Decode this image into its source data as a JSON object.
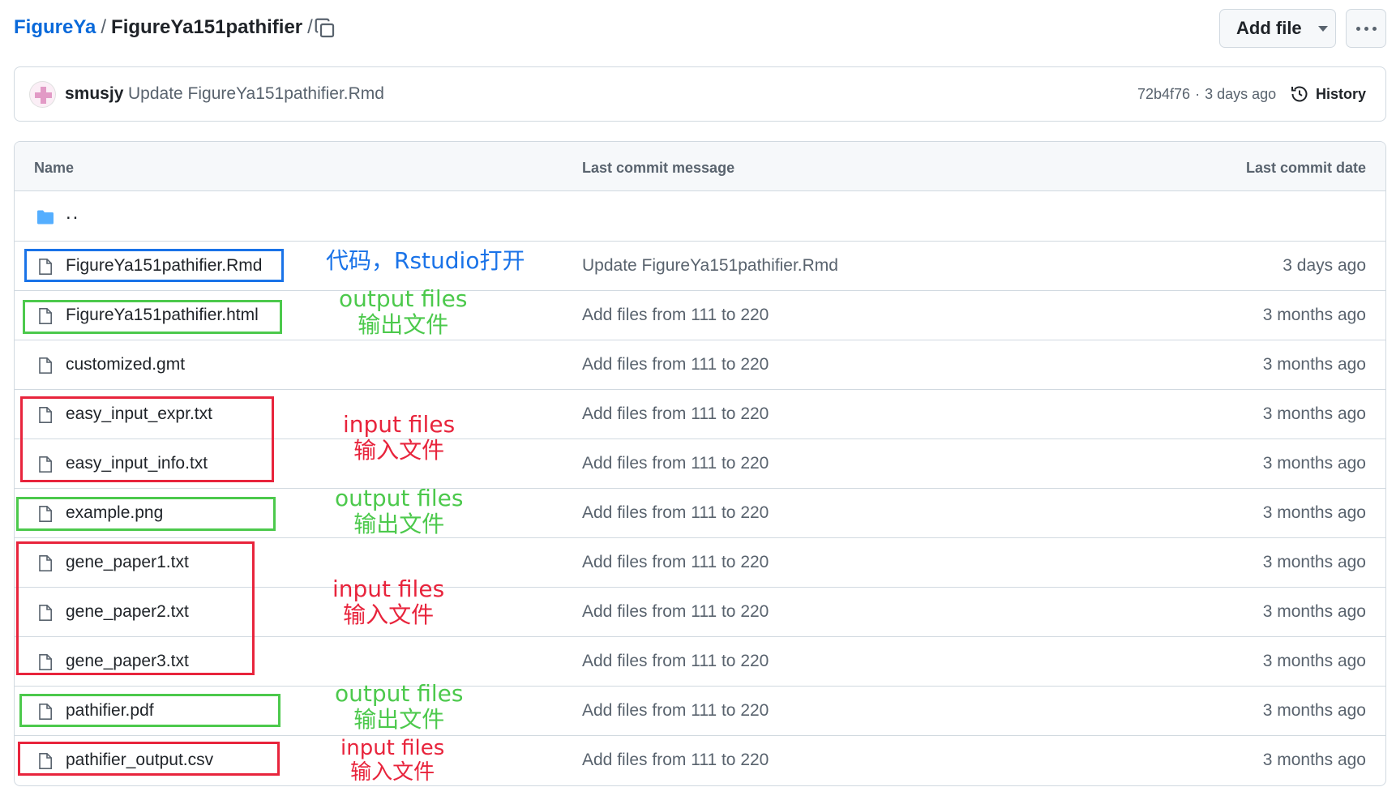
{
  "breadcrumb": {
    "owner": "FigureYa",
    "separator": "/",
    "repo": "FigureYa151pathifier",
    "trailing_separator": "/"
  },
  "toolbar": {
    "add_file_label": "Add file",
    "more_icon": "kebab-horizontal-icon",
    "copy_icon": "copy-icon"
  },
  "commit": {
    "author": "smusjy",
    "message": "Update FigureYa151pathifier.Rmd",
    "sha": "72b4f76",
    "dot": "·",
    "age": "3 days ago",
    "history_label": "History"
  },
  "table": {
    "headers": {
      "name": "Name",
      "message": "Last commit message",
      "date": "Last commit date"
    },
    "parent_dir": "..",
    "files": [
      {
        "name": "FigureYa151pathifier.Rmd",
        "message": "Update FigureYa151pathifier.Rmd",
        "date": "3 days ago"
      },
      {
        "name": "FigureYa151pathifier.html",
        "message": "Add files from 111 to 220",
        "date": "3 months ago"
      },
      {
        "name": "customized.gmt",
        "message": "Add files from 111 to 220",
        "date": "3 months ago"
      },
      {
        "name": "easy_input_expr.txt",
        "message": "Add files from 111 to 220",
        "date": "3 months ago"
      },
      {
        "name": "easy_input_info.txt",
        "message": "Add files from 111 to 220",
        "date": "3 months ago"
      },
      {
        "name": "example.png",
        "message": "Add files from 111 to 220",
        "date": "3 months ago"
      },
      {
        "name": "gene_paper1.txt",
        "message": "Add files from 111 to 220",
        "date": "3 months ago"
      },
      {
        "name": "gene_paper2.txt",
        "message": "Add files from 111 to 220",
        "date": "3 months ago"
      },
      {
        "name": "gene_paper3.txt",
        "message": "Add files from 111 to 220",
        "date": "3 months ago"
      },
      {
        "name": "pathifier.pdf",
        "message": "Add files from 111 to 220",
        "date": "3 months ago"
      },
      {
        "name": "pathifier_output.csv",
        "message": "Add files from 111 to 220",
        "date": "3 months ago"
      }
    ]
  },
  "annotations": {
    "code": "代码，Rstudio打开",
    "output_en": "output files",
    "output_zh": "输出文件",
    "input_en": "input files",
    "input_zh": "输入文件"
  },
  "colors": {
    "link": "#0969da",
    "blue_annotation": "#1a73e8",
    "green_annotation": "#4cc94c",
    "red_annotation": "#e8243c"
  }
}
